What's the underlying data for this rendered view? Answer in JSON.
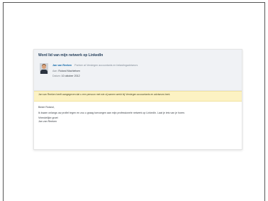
{
  "email": {
    "subject": "Word lid van mijn netwerk op LinkedIn",
    "sender": {
      "name": "Jan van Reeken",
      "role": "Partner at Verstegen accountants en belastingadviseurs"
    },
    "to_label": "Aan:",
    "to_value": "Roland Machielsen",
    "date_label": "Datum:",
    "date_value": "10 oktober 2012",
    "notice": "Jan van Reeken heeft aangegeven dat u een persoon met wie zij samen werkt bij Verstegen accountants en adviseurs bent.",
    "greeting": "Beste Roland,",
    "message": "Ik kwam onlangs uw profiel tegen en zou u graag toevoegen aan mijn professionele netwerk op LinkedIn. Laat je iets van je horen.",
    "closing": "Vriendelijke groet",
    "signature": "Jan van Reeken"
  }
}
